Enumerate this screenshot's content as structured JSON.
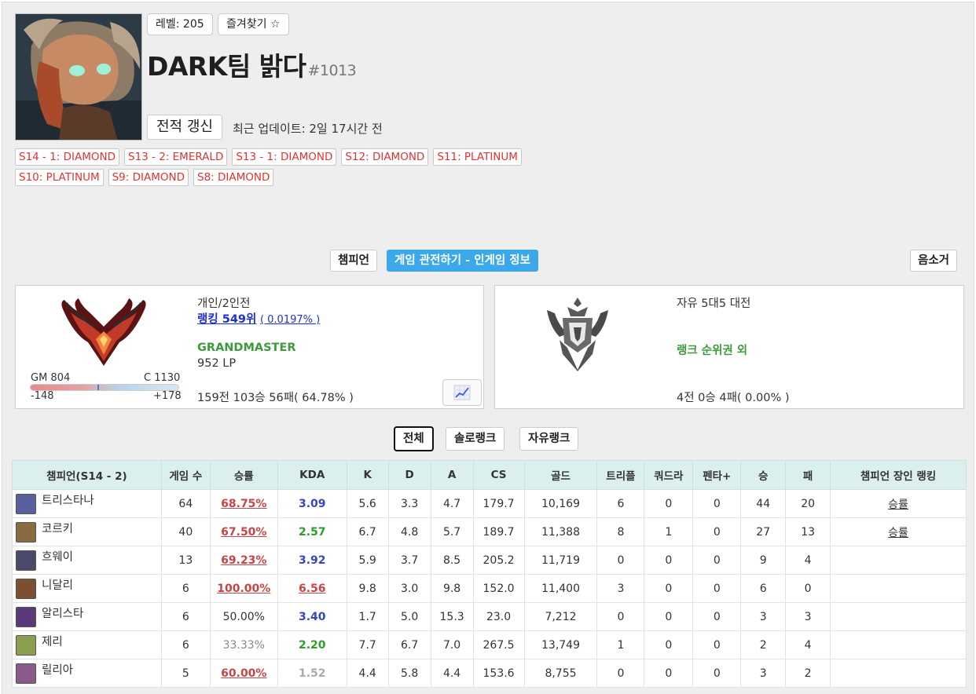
{
  "profile": {
    "level": "레벨: 205",
    "favorite": "즐겨찾기 ☆",
    "name": "DARK팀 밝다",
    "tag": "#1013",
    "refresh": "전적 갱신",
    "updated": "최근 업데이트: 2일 17시간 전"
  },
  "seasons": [
    "S14 - 1: DIAMOND",
    "S13 - 2: EMERALD",
    "S13 - 1: DIAMOND",
    "S12: DIAMOND",
    "S11: PLATINUM",
    "S10: PLATINUM",
    "S9: DIAMOND",
    "S8: DIAMOND"
  ],
  "tabs": {
    "champion": "챔피언",
    "spectate": "게임 관전하기 - 인게임 정보",
    "mute": "음소거"
  },
  "solo": {
    "queue": "개인/2인전",
    "ranking": "랭킹 549위",
    "ranking_pct": "( 0.0197% )",
    "tier": "GRANDMASTER",
    "lp": "952 LP",
    "gm_cut": "GM 804",
    "c_cut": "C 1130",
    "to_gm": "-148",
    "to_c": "+178",
    "progress": 0.45,
    "record": "159전 103승 56패( 64.78% )"
  },
  "flex": {
    "queue": "자유 5대5 대전",
    "tier": "랭크 순위권 외",
    "record": "4전 0승 4패( 0.00% )"
  },
  "filters": [
    "전체",
    "솔로랭크",
    "자유랭크"
  ],
  "table": {
    "headers": [
      "챔피언(S14 - 2)",
      "게임 수",
      "승률",
      "KDA",
      "K",
      "D",
      "A",
      "CS",
      "골드",
      "트리플",
      "쿼드라",
      "펜타+",
      "승",
      "패",
      "챔피언 장인 랭킹"
    ],
    "rows": [
      {
        "name": "트리스타나",
        "games": "64",
        "wr": "68.75%",
        "wrClass": "wr-hi",
        "kda": "3.09",
        "kdaClass": "kda-blue",
        "k": "5.6",
        "d": "3.3",
        "a": "4.7",
        "cs": "179.7",
        "gold": "10,169",
        "triple": "6",
        "quadra": "0",
        "penta": "0",
        "w": "44",
        "l": "20",
        "rank": "승률",
        "color": "#5a5f9e"
      },
      {
        "name": "코르키",
        "games": "40",
        "wr": "67.50%",
        "wrClass": "wr-hi",
        "kda": "2.57",
        "kdaClass": "kda-green",
        "k": "6.7",
        "d": "4.8",
        "a": "5.7",
        "cs": "189.7",
        "gold": "11,388",
        "triple": "8",
        "quadra": "1",
        "penta": "0",
        "w": "27",
        "l": "13",
        "rank": "승률",
        "color": "#8a6a40"
      },
      {
        "name": "흐웨이",
        "games": "13",
        "wr": "69.23%",
        "wrClass": "wr-hi",
        "kda": "3.92",
        "kdaClass": "kda-blue",
        "k": "5.9",
        "d": "3.7",
        "a": "8.5",
        "cs": "205.2",
        "gold": "11,719",
        "triple": "0",
        "quadra": "0",
        "penta": "0",
        "w": "9",
        "l": "4",
        "rank": "",
        "color": "#4a4a6a"
      },
      {
        "name": "니달리",
        "games": "6",
        "wr": "100.00%",
        "wrClass": "wr-hi",
        "kda": "6.56",
        "kdaClass": "kda-red",
        "k": "9.8",
        "d": "3.0",
        "a": "9.8",
        "cs": "152.0",
        "gold": "11,400",
        "triple": "3",
        "quadra": "0",
        "penta": "0",
        "w": "6",
        "l": "0",
        "rank": "",
        "color": "#7a5030"
      },
      {
        "name": "알리스타",
        "games": "6",
        "wr": "50.00%",
        "wrClass": "wr-mid",
        "kda": "3.40",
        "kdaClass": "kda-blue",
        "k": "1.7",
        "d": "5.0",
        "a": "15.3",
        "cs": "23.0",
        "gold": "7,212",
        "triple": "0",
        "quadra": "0",
        "penta": "0",
        "w": "3",
        "l": "3",
        "rank": "",
        "color": "#5a3a7a"
      },
      {
        "name": "제리",
        "games": "6",
        "wr": "33.33%",
        "wrClass": "wr-low",
        "kda": "2.20",
        "kdaClass": "kda-green",
        "k": "7.7",
        "d": "6.7",
        "a": "7.0",
        "cs": "267.5",
        "gold": "13,749",
        "triple": "1",
        "quadra": "0",
        "penta": "0",
        "w": "2",
        "l": "4",
        "rank": "",
        "color": "#8aa050"
      },
      {
        "name": "릴리아",
        "games": "5",
        "wr": "60.00%",
        "wrClass": "wr-hi",
        "kda": "1.52",
        "kdaClass": "kda-gray",
        "k": "4.4",
        "d": "5.8",
        "a": "4.4",
        "cs": "153.6",
        "gold": "8,755",
        "triple": "0",
        "quadra": "0",
        "penta": "0",
        "w": "3",
        "l": "2",
        "rank": "",
        "color": "#8a5a8a"
      }
    ]
  }
}
